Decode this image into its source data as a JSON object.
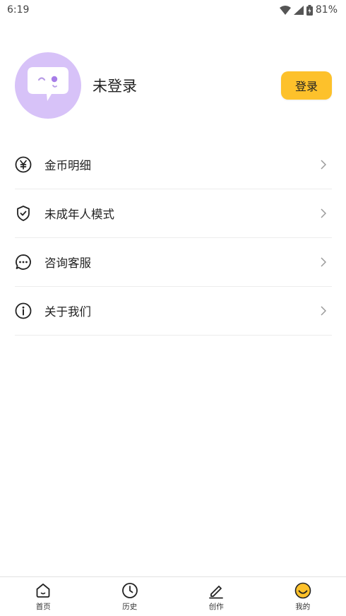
{
  "status_bar": {
    "time": "6:19",
    "battery": "81%"
  },
  "profile": {
    "username": "未登录",
    "login_label": "登录",
    "avatar_icon": "chat-bubble-face-icon"
  },
  "menu": {
    "items": [
      {
        "label": "金币明细",
        "icon": "yen-coin-icon"
      },
      {
        "label": "未成年人模式",
        "icon": "shield-check-icon"
      },
      {
        "label": "咨询客服",
        "icon": "chat-dots-icon"
      },
      {
        "label": "关于我们",
        "icon": "info-circle-icon"
      }
    ]
  },
  "tabbar": {
    "tabs": [
      {
        "label": "首页",
        "icon": "home-icon"
      },
      {
        "label": "历史",
        "icon": "clock-icon"
      },
      {
        "label": "创作",
        "icon": "pencil-icon"
      },
      {
        "label": "我的",
        "icon": "smiley-icon",
        "active": true
      }
    ]
  },
  "colors": {
    "accent": "#fdc12b",
    "avatar_bg": "#d7c2f8"
  }
}
